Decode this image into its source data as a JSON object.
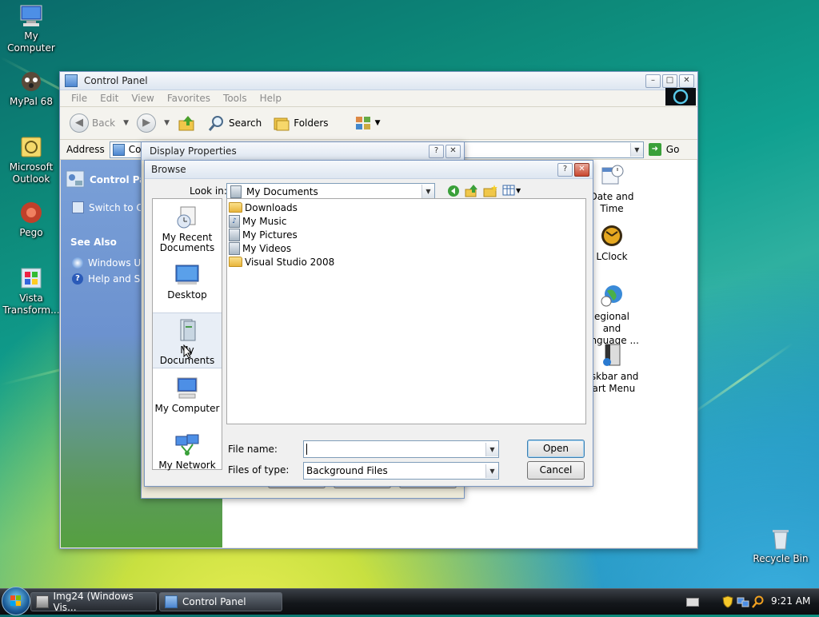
{
  "desktop": {
    "icons": [
      {
        "label": "My Computer",
        "icon": "computer-icon"
      },
      {
        "label": "MyPal 68",
        "icon": "mypal-icon"
      },
      {
        "label": "Microsoft Outlook",
        "icon": "outlook-icon"
      },
      {
        "label": "Pego",
        "icon": "pego-icon"
      },
      {
        "label": "Vista Transform...",
        "icon": "vista-transform-icon"
      },
      {
        "label": "Recycle Bin",
        "icon": "recycle-bin-icon"
      }
    ]
  },
  "control_panel": {
    "title": "Control Panel",
    "menu": [
      "File",
      "Edit",
      "View",
      "Favorites",
      "Tools",
      "Help"
    ],
    "toolbar": {
      "back": "Back",
      "search": "Search",
      "folders": "Folders"
    },
    "address_label": "Address",
    "address_value": "Cont",
    "go_label": "Go",
    "side": {
      "header": "Control Panel",
      "switch": "Switch to Ca",
      "see_also": "See Also",
      "links": [
        "Windows Up",
        "Help and Su"
      ]
    },
    "items": [
      {
        "label": "Date and Time",
        "icon": "date-time-icon"
      },
      {
        "label": "LClock",
        "icon": "lclock-icon"
      },
      {
        "label": "egional and anguage ...",
        "icon": "regional-language-icon"
      },
      {
        "label": "askbar and tart Menu",
        "icon": "taskbar-start-menu-icon"
      }
    ]
  },
  "display_properties": {
    "title": "Display Properties"
  },
  "browse": {
    "title": "Browse",
    "look_in_label": "Look in:",
    "look_in_value": "My Documents",
    "places": [
      "My Recent Documents",
      "Desktop",
      "My Documents",
      "My Computer",
      "My Network"
    ],
    "selected_place": "My Documents",
    "files": [
      {
        "name": "Downloads",
        "type": "folder"
      },
      {
        "name": "My Music",
        "type": "music"
      },
      {
        "name": "My Pictures",
        "type": "pictures"
      },
      {
        "name": "My Videos",
        "type": "videos"
      },
      {
        "name": "Visual Studio 2008",
        "type": "folder"
      }
    ],
    "file_name_label": "File name:",
    "file_name_value": "",
    "files_of_type_label": "Files of type:",
    "files_of_type_value": "Background Files",
    "open_label": "Open",
    "cancel_label": "Cancel"
  },
  "taskbar": {
    "buttons": [
      "Img24 (Windows Vis...",
      "Control Panel"
    ],
    "time": "9:21 AM"
  },
  "colors": {
    "accent": "#3c7fb1",
    "sidebar_top": "#7aa0d8",
    "close_red": "#c9472f"
  }
}
